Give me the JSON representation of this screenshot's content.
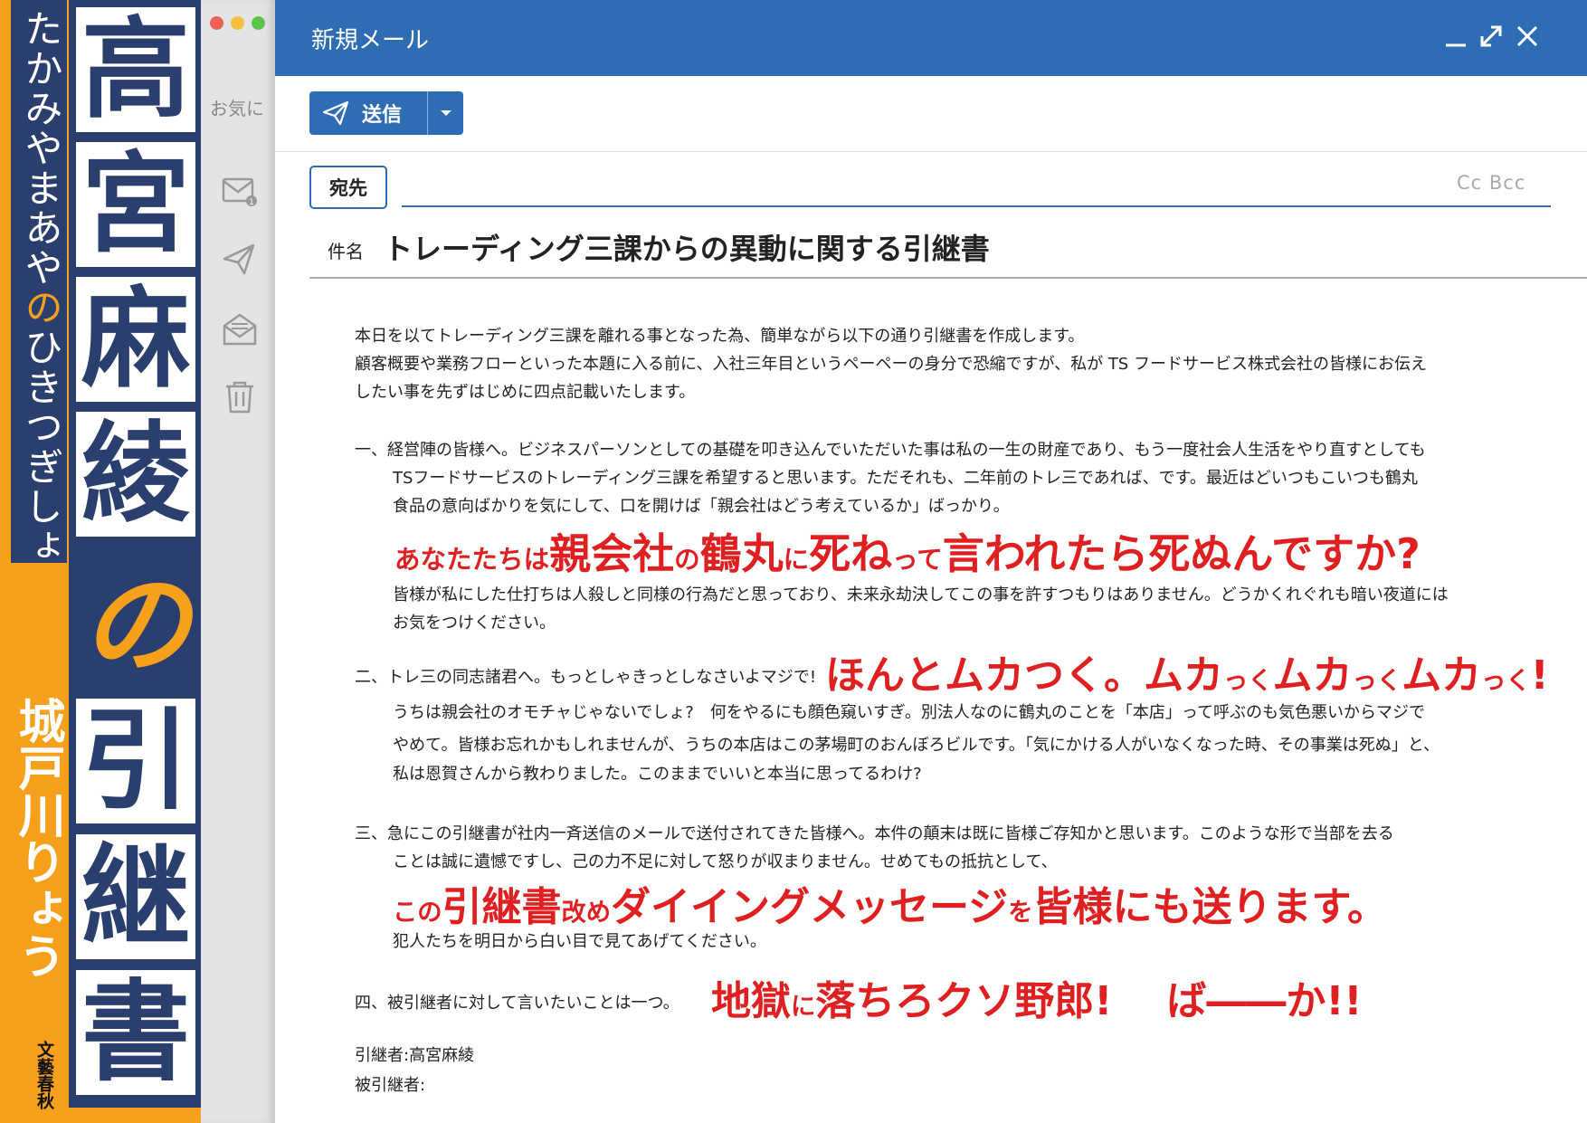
{
  "cover": {
    "subtitle": "たかみやまあや",
    "subtitle_no": "の",
    "subtitle_rest": "ひきつぎしょ",
    "title_chars": [
      "高",
      "宮",
      "麻",
      "綾",
      "の",
      "引",
      "継",
      "書"
    ],
    "author": "城戸川りょう",
    "publisher": "文藝春秋"
  },
  "sidebar": {
    "favorites_label": "お気に",
    "icons": [
      "inbox-icon",
      "sent-icon",
      "opened-mail-icon",
      "trash-icon"
    ],
    "inbox_badge": "1"
  },
  "window": {
    "title": "新規メール",
    "send_label": "送信",
    "to_label": "宛先",
    "cc_bcc": "Cc Bcc",
    "subject_label": "件名",
    "subject": "トレーディング三課からの異動に関する引継書"
  },
  "body": {
    "intro1": "本日を以てトレーディング三課を離れる事となった為、簡単ながら以下の通り引継書を作成します。",
    "intro2": "顧客概要や業務フローといった本題に入る前に、入社三年目というペーペーの身分で恐縮ですが、私が TS フードサービス株式会社の皆様にお伝え",
    "intro3": "したい事を先ずはじめに四点記載いたします。",
    "p1_line1": "一、経営陣の皆様へ。ビジネスパーソンとしての基礎を叩き込んでいただいた事は私の一生の財産であり、もう一度社会人生活をやり直すとしても",
    "p1_line2": "TSフードサービスのトレーディング三課を希望すると思います。ただそれも、二年前のトレ三であれば、です。最近はどいつもこいつも鶴丸",
    "p1_line3": "食品の意向ばかりを気にして、口を開けば「親会社はどう考えているか」ばっかり。",
    "p1_red": [
      "あなたたちは",
      "親会社",
      "の",
      "鶴丸",
      "に",
      "死ね",
      "って",
      "言われたら死ぬんですか?"
    ],
    "p1_line4": "皆様が私にした仕打ちは人殺しと同様の行為だと思っており、未来永劫決してこの事を許すつもりはありません。どうかくれぐれも暗い夜道には",
    "p1_line5": "お気をつけください。",
    "p2_line1": "二、トレ三の同志諸君へ。もっとしゃきっとしなさいよマジで!",
    "p2_red": [
      "ほんとムカつく。ムカ",
      "っく",
      "ムカ",
      "っく",
      "ムカ",
      "っく",
      "!"
    ],
    "p2_line2": "うちは親会社のオモチャじゃないでしょ?　何をやるにも顔色窺いすぎ。別法人なのに鶴丸のことを「本店」って呼ぶのも気色悪いからマジで",
    "p2_line3": "やめて。皆様お忘れかもしれませんが、うちの本店はこの茅場町のおんぼろビルです。「気にかける人がいなくなった時、その事業は死ぬ」と、",
    "p2_line4": "私は恩賀さんから教わりました。このままでいいと本当に思ってるわけ?",
    "p3_line1": "三、急にこの引継書が社内一斉送信のメールで送付されてきた皆様へ。本件の顛末は既に皆様ご存知かと思います。このような形で当部を去る",
    "p3_line2": "ことは誠に遺憾ですし、己の力不足に対して怒りが収まりません。せめてもの抵抗として、",
    "p3_red": [
      "この",
      "引継書",
      "改め",
      "ダイイングメッセージ",
      "を",
      "皆様にも送ります。"
    ],
    "p3_line3": "犯人たちを明日から白い目で見てあげてください。",
    "p4_line1": "四、被引継者に対して言いたいことは一つ。",
    "p4_red": [
      "地獄",
      "に",
      "落ちろクソ野郎!",
      "ば――か!!"
    ],
    "signature1": "引継者:高宮麻綾",
    "signature2": "被引継者:"
  },
  "colors": {
    "accent": "#2e6db4",
    "cover_navy": "#2b3f6e",
    "cover_orange": "#f7a01c",
    "alert_red": "#e02020"
  }
}
